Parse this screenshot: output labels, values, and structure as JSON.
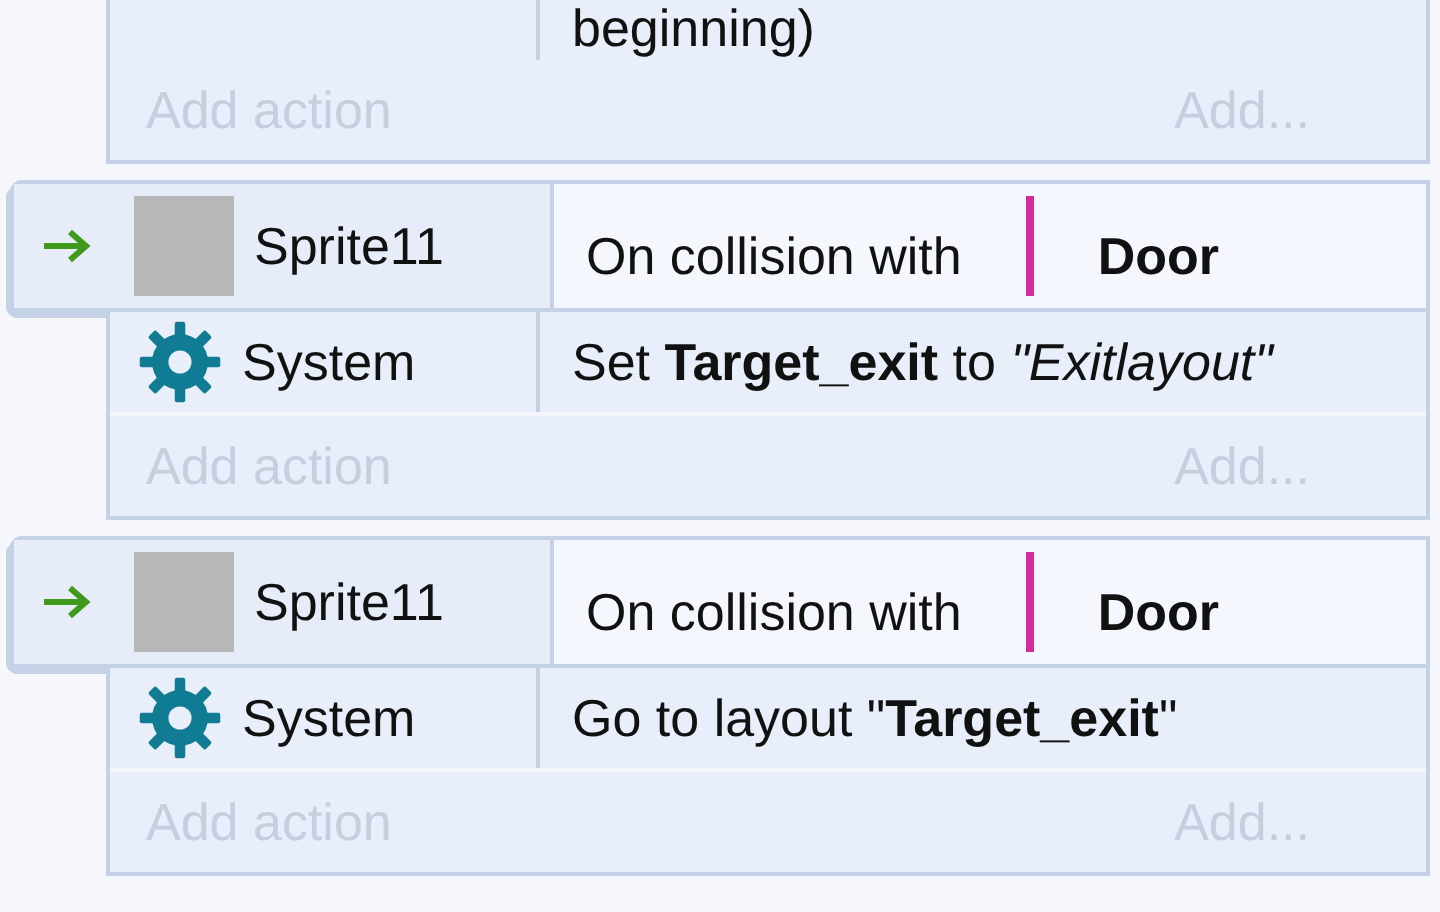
{
  "previous_event": {
    "cut_action": {
      "text": "beginning)"
    },
    "add_action": "Add action",
    "add": "Add..."
  },
  "events": [
    {
      "condition": {
        "object": "Sprite11",
        "text": "On collision with",
        "parameter": "Door"
      },
      "actions": [
        {
          "object": "System",
          "text": "Set **Target_exit** to *\"Exitlayout\"*"
        }
      ],
      "add_action": "Add action",
      "add": "Add..."
    },
    {
      "condition": {
        "object": "Sprite11",
        "text": "On collision with",
        "parameter": "Door"
      },
      "actions": [
        {
          "object": "System",
          "text": "Go to layout \"**Target_exit**\""
        }
      ],
      "add_action": "Add action",
      "add": "Add..."
    }
  ]
}
